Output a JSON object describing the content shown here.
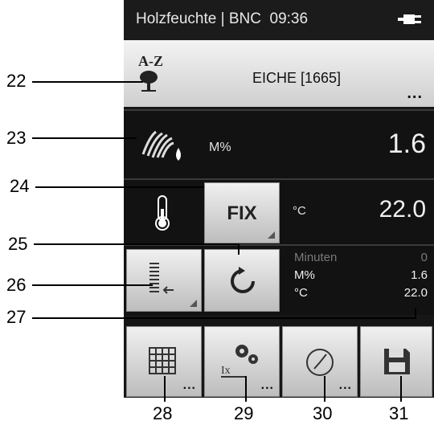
{
  "status": {
    "title": "Holzfeuchte | BNC",
    "time": "09:36",
    "power_icon": "plug-icon"
  },
  "species": {
    "az_label": "A-Z",
    "name": "EICHE [1665]",
    "more": "..."
  },
  "moisture": {
    "unit": "M%",
    "value": "1.6"
  },
  "temperature": {
    "fix_label": "FIX",
    "unit": "°C",
    "value": "22.0"
  },
  "log": {
    "rows": [
      {
        "label": "Minuten",
        "value": "0"
      },
      {
        "label": "M%",
        "value": "1.6"
      },
      {
        "label": "°C",
        "value": "22.0"
      }
    ]
  },
  "toolbar": {
    "more": "..."
  },
  "callouts": {
    "c22": "22",
    "c23": "23",
    "c24": "24",
    "c25": "25",
    "c26": "26",
    "c27": "27",
    "c28": "28",
    "c29": "29",
    "c30": "30",
    "c31": "31"
  },
  "colors": {
    "screen_bg": "#161616",
    "button_light": "#f0f0f0",
    "text_dim": "#7a7a7a",
    "text_bright": "#f0f0f0"
  }
}
